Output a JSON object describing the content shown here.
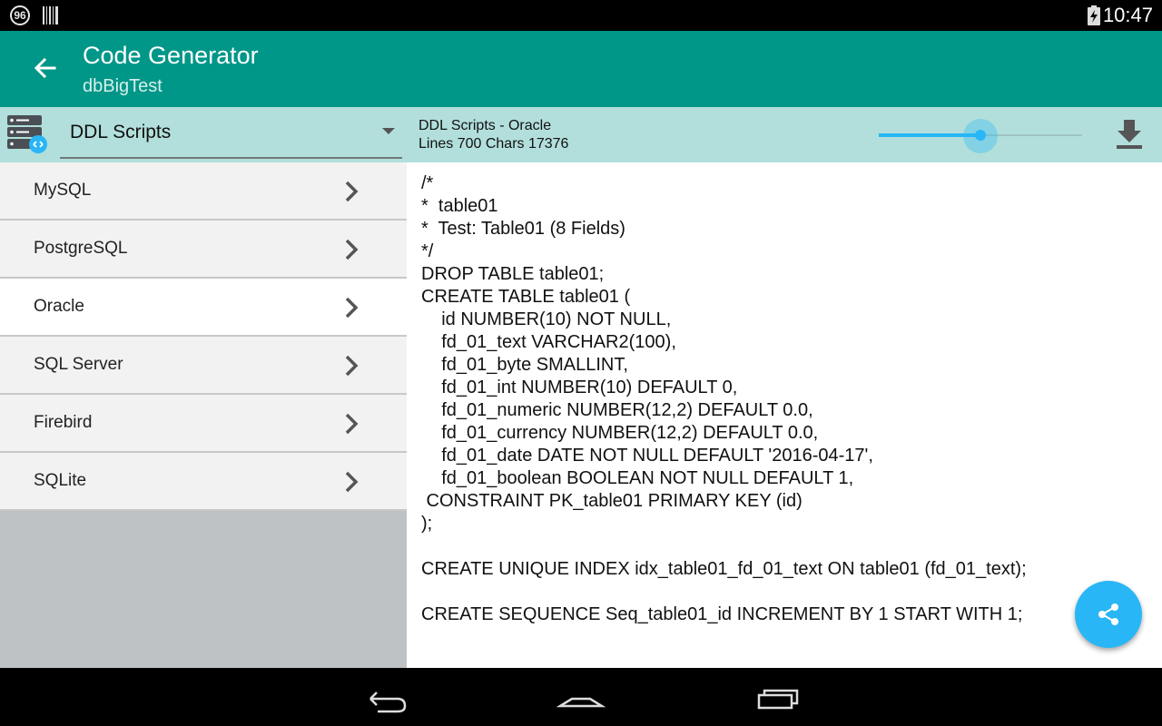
{
  "status_bar": {
    "notification_badge": "96",
    "icons": [
      "barcode-icon",
      "battery-charging-icon"
    ],
    "time": "10:47"
  },
  "app_bar": {
    "title": "Code Generator",
    "subtitle": "dbBigTest",
    "back_icon": "arrow-back-icon"
  },
  "selector": {
    "icon": "database-server-icon",
    "value": "DDL Scripts"
  },
  "databases": [
    {
      "label": "MySQL",
      "selected": false
    },
    {
      "label": "PostgreSQL",
      "selected": false
    },
    {
      "label": "Oracle",
      "selected": true
    },
    {
      "label": "SQL Server",
      "selected": false
    },
    {
      "label": "Firebird",
      "selected": false
    },
    {
      "label": "SQLite",
      "selected": false
    }
  ],
  "info": {
    "title": "DDL Scripts - Oracle",
    "stats": "Lines 700 Chars 17376",
    "zoom_fraction": 0.5
  },
  "code": "/*\n*  table01\n*  Test: Table01 (8 Fields)\n*/\nDROP TABLE table01;\nCREATE TABLE table01 (\n    id NUMBER(10) NOT NULL,\n    fd_01_text VARCHAR2(100),\n    fd_01_byte SMALLINT,\n    fd_01_int NUMBER(10) DEFAULT 0,\n    fd_01_numeric NUMBER(12,2) DEFAULT 0.0,\n    fd_01_currency NUMBER(12,2) DEFAULT 0.0,\n    fd_01_date DATE NOT NULL DEFAULT '2016-04-17',\n    fd_01_boolean BOOLEAN NOT NULL DEFAULT 1,\n CONSTRAINT PK_table01 PRIMARY KEY (id)\n);\n\nCREATE UNIQUE INDEX idx_table01_fd_01_text ON table01 (fd_01_text);\n\nCREATE SEQUENCE Seq_table01_id INCREMENT BY 1 START WITH 1;",
  "colors": {
    "app_bar": "#009688",
    "header_tint": "#b2dfdb",
    "accent": "#29b6f6"
  },
  "nav_icons": [
    "back-nav-icon",
    "home-nav-icon",
    "recents-nav-icon"
  ]
}
